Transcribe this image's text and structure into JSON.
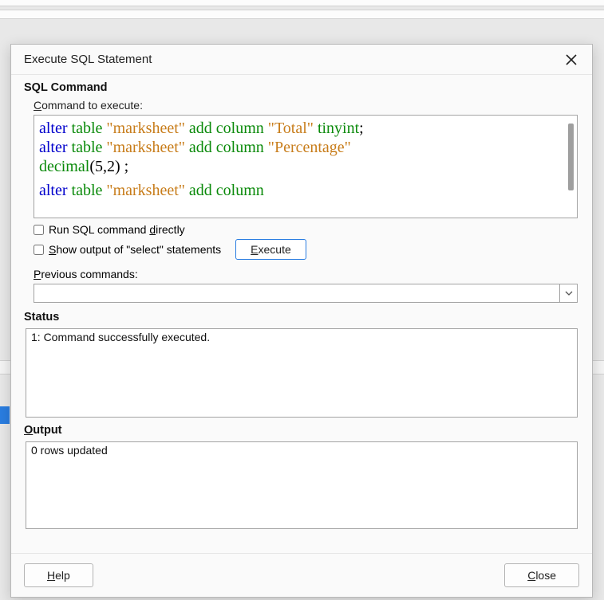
{
  "dialog": {
    "title": "Execute SQL Statement",
    "sqlCommand": {
      "header": "SQL Command",
      "commandLabelPre": "C",
      "commandLabelPost": "ommand to execute:",
      "sql": {
        "l1_alter": "alter ",
        "l1_table": "table ",
        "l1_str1": "\"marksheet\" ",
        "l1_add": "add column ",
        "l1_str2": "\"Total\" ",
        "l1_type": "tinyint",
        "l1_semi": ";",
        "l2_alter": "alter ",
        "l2_table": "table ",
        "l2_str1": "\"marksheet\" ",
        "l2_add": "add column ",
        "l2_str2": "\"Percentage\"",
        "l3_type": "decimal",
        "l3_args": "(5,2) ;",
        "l4_alter": "alter ",
        "l4_table": "table ",
        "l4_str1": "\"marksheet\" ",
        "l4_add": "add column"
      },
      "runDirectPre": "Run SQL command ",
      "runDirectMn": "d",
      "runDirectPost": "irectly",
      "showOutputMn": "S",
      "showOutputPost": "how output of \"select\" statements",
      "executeMn": "E",
      "executePost": "xecute",
      "prevMn": "P",
      "prevPost": "revious commands:"
    },
    "status": {
      "header": "Status",
      "text": "1: Command successfully executed."
    },
    "output": {
      "headerMn": "O",
      "headerPost": "utput",
      "text": "0 rows updated"
    },
    "footer": {
      "helpMn": "H",
      "helpPost": "elp",
      "closeMn": "C",
      "closePost": "lose"
    }
  }
}
